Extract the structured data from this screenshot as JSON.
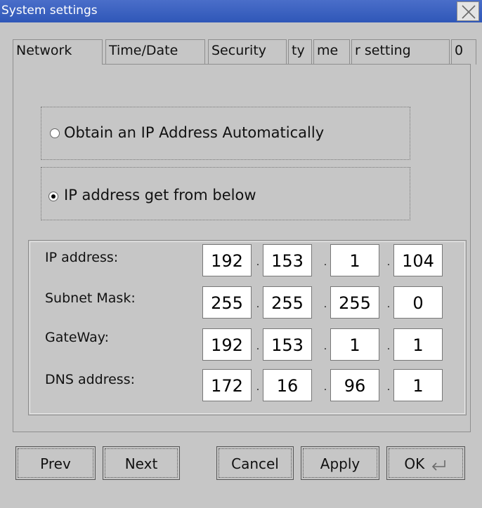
{
  "window": {
    "title": "System settings"
  },
  "tabs": [
    {
      "label": "Network",
      "active": true
    },
    {
      "label": "Time/Date"
    },
    {
      "label": "Security"
    },
    {
      "label": "ty"
    },
    {
      "label": "me"
    },
    {
      "label": "r setting"
    },
    {
      "label": "0"
    }
  ],
  "ip_mode": {
    "options": [
      {
        "label": "Obtain an IP Address Automatically",
        "selected": false
      },
      {
        "label": "IP address get from below",
        "selected": true
      }
    ]
  },
  "ip_fields": [
    {
      "label": "IP address:",
      "octets": [
        "192",
        "153",
        "1",
        "104"
      ]
    },
    {
      "label": "Subnet Mask:",
      "octets": [
        "255",
        "255",
        "255",
        "0"
      ]
    },
    {
      "label": "GateWay:",
      "octets": [
        "192",
        "153",
        "1",
        "1"
      ]
    },
    {
      "label": "DNS address:",
      "octets": [
        "172",
        "16",
        "96",
        "1"
      ]
    }
  ],
  "buttons": {
    "prev": "Prev",
    "next": "Next",
    "cancel": "Cancel",
    "apply": "Apply",
    "ok": "OK"
  },
  "icons": {
    "close": "close-icon",
    "enter": "enter-icon"
  }
}
